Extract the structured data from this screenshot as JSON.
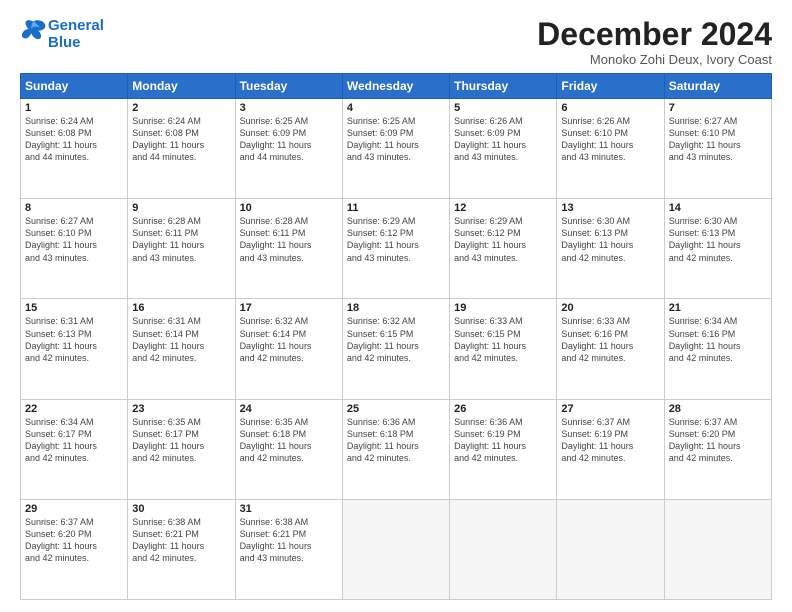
{
  "header": {
    "logo_line1": "General",
    "logo_line2": "Blue",
    "month_title": "December 2024",
    "location": "Monoko Zohi Deux, Ivory Coast"
  },
  "days_of_week": [
    "Sunday",
    "Monday",
    "Tuesday",
    "Wednesday",
    "Thursday",
    "Friday",
    "Saturday"
  ],
  "weeks": [
    [
      {
        "day": "1",
        "info": "Sunrise: 6:24 AM\nSunset: 6:08 PM\nDaylight: 11 hours\nand 44 minutes."
      },
      {
        "day": "2",
        "info": "Sunrise: 6:24 AM\nSunset: 6:08 PM\nDaylight: 11 hours\nand 44 minutes."
      },
      {
        "day": "3",
        "info": "Sunrise: 6:25 AM\nSunset: 6:09 PM\nDaylight: 11 hours\nand 44 minutes."
      },
      {
        "day": "4",
        "info": "Sunrise: 6:25 AM\nSunset: 6:09 PM\nDaylight: 11 hours\nand 43 minutes."
      },
      {
        "day": "5",
        "info": "Sunrise: 6:26 AM\nSunset: 6:09 PM\nDaylight: 11 hours\nand 43 minutes."
      },
      {
        "day": "6",
        "info": "Sunrise: 6:26 AM\nSunset: 6:10 PM\nDaylight: 11 hours\nand 43 minutes."
      },
      {
        "day": "7",
        "info": "Sunrise: 6:27 AM\nSunset: 6:10 PM\nDaylight: 11 hours\nand 43 minutes."
      }
    ],
    [
      {
        "day": "8",
        "info": "Sunrise: 6:27 AM\nSunset: 6:10 PM\nDaylight: 11 hours\nand 43 minutes."
      },
      {
        "day": "9",
        "info": "Sunrise: 6:28 AM\nSunset: 6:11 PM\nDaylight: 11 hours\nand 43 minutes."
      },
      {
        "day": "10",
        "info": "Sunrise: 6:28 AM\nSunset: 6:11 PM\nDaylight: 11 hours\nand 43 minutes."
      },
      {
        "day": "11",
        "info": "Sunrise: 6:29 AM\nSunset: 6:12 PM\nDaylight: 11 hours\nand 43 minutes."
      },
      {
        "day": "12",
        "info": "Sunrise: 6:29 AM\nSunset: 6:12 PM\nDaylight: 11 hours\nand 43 minutes."
      },
      {
        "day": "13",
        "info": "Sunrise: 6:30 AM\nSunset: 6:13 PM\nDaylight: 11 hours\nand 42 minutes."
      },
      {
        "day": "14",
        "info": "Sunrise: 6:30 AM\nSunset: 6:13 PM\nDaylight: 11 hours\nand 42 minutes."
      }
    ],
    [
      {
        "day": "15",
        "info": "Sunrise: 6:31 AM\nSunset: 6:13 PM\nDaylight: 11 hours\nand 42 minutes."
      },
      {
        "day": "16",
        "info": "Sunrise: 6:31 AM\nSunset: 6:14 PM\nDaylight: 11 hours\nand 42 minutes."
      },
      {
        "day": "17",
        "info": "Sunrise: 6:32 AM\nSunset: 6:14 PM\nDaylight: 11 hours\nand 42 minutes."
      },
      {
        "day": "18",
        "info": "Sunrise: 6:32 AM\nSunset: 6:15 PM\nDaylight: 11 hours\nand 42 minutes."
      },
      {
        "day": "19",
        "info": "Sunrise: 6:33 AM\nSunset: 6:15 PM\nDaylight: 11 hours\nand 42 minutes."
      },
      {
        "day": "20",
        "info": "Sunrise: 6:33 AM\nSunset: 6:16 PM\nDaylight: 11 hours\nand 42 minutes."
      },
      {
        "day": "21",
        "info": "Sunrise: 6:34 AM\nSunset: 6:16 PM\nDaylight: 11 hours\nand 42 minutes."
      }
    ],
    [
      {
        "day": "22",
        "info": "Sunrise: 6:34 AM\nSunset: 6:17 PM\nDaylight: 11 hours\nand 42 minutes."
      },
      {
        "day": "23",
        "info": "Sunrise: 6:35 AM\nSunset: 6:17 PM\nDaylight: 11 hours\nand 42 minutes."
      },
      {
        "day": "24",
        "info": "Sunrise: 6:35 AM\nSunset: 6:18 PM\nDaylight: 11 hours\nand 42 minutes."
      },
      {
        "day": "25",
        "info": "Sunrise: 6:36 AM\nSunset: 6:18 PM\nDaylight: 11 hours\nand 42 minutes."
      },
      {
        "day": "26",
        "info": "Sunrise: 6:36 AM\nSunset: 6:19 PM\nDaylight: 11 hours\nand 42 minutes."
      },
      {
        "day": "27",
        "info": "Sunrise: 6:37 AM\nSunset: 6:19 PM\nDaylight: 11 hours\nand 42 minutes."
      },
      {
        "day": "28",
        "info": "Sunrise: 6:37 AM\nSunset: 6:20 PM\nDaylight: 11 hours\nand 42 minutes."
      }
    ],
    [
      {
        "day": "29",
        "info": "Sunrise: 6:37 AM\nSunset: 6:20 PM\nDaylight: 11 hours\nand 42 minutes."
      },
      {
        "day": "30",
        "info": "Sunrise: 6:38 AM\nSunset: 6:21 PM\nDaylight: 11 hours\nand 42 minutes."
      },
      {
        "day": "31",
        "info": "Sunrise: 6:38 AM\nSunset: 6:21 PM\nDaylight: 11 hours\nand 43 minutes."
      },
      {
        "day": "",
        "info": ""
      },
      {
        "day": "",
        "info": ""
      },
      {
        "day": "",
        "info": ""
      },
      {
        "day": "",
        "info": ""
      }
    ]
  ]
}
